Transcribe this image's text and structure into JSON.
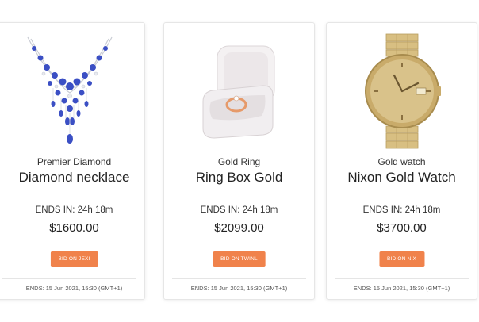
{
  "cards": [
    {
      "subtitle": "Premier Diamond",
      "title": "Diamond necklace",
      "ends_in": "ENDS IN: 24h 18m",
      "price": "$1600.00",
      "bid_label": "BID ON JEXI",
      "ends_date": "ENDS: 15 Jun 2021, 15:30 (GMT+1)",
      "image": "necklace-image"
    },
    {
      "subtitle": "Gold Ring",
      "title": "Ring Box Gold",
      "ends_in": "ENDS IN: 24h 18m",
      "price": "$2099.00",
      "bid_label": "BID ON TWINL",
      "ends_date": "ENDS: 15 Jun 2021, 15:30 (GMT+1)",
      "image": "ring-box-image"
    },
    {
      "subtitle": "Gold watch",
      "title": "Nixon Gold Watch",
      "ends_in": "ENDS IN: 24h 18m",
      "price": "$3700.00",
      "bid_label": "BID ON NIX",
      "ends_date": "ENDS: 15 Jun 2021, 15:30 (GMT+1)",
      "image": "watch-image"
    }
  ],
  "colors": {
    "accent": "#f0824b",
    "border": "#e6e6e6",
    "text": "#222222"
  }
}
